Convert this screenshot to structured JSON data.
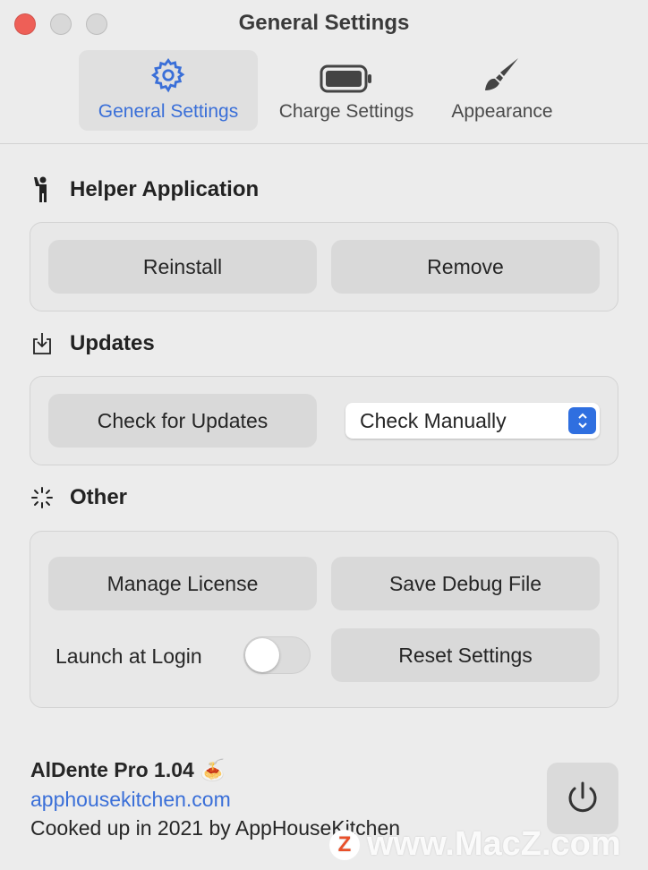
{
  "window": {
    "title": "General Settings",
    "colors": {
      "close": "#ee5f57",
      "inactive": "#d8d8d8",
      "accent": "#3a6fd8"
    }
  },
  "tabs": [
    {
      "label": "General Settings",
      "icon": "gear-icon",
      "selected": true
    },
    {
      "label": "Charge Settings",
      "icon": "battery-icon"
    },
    {
      "label": "Appearance",
      "icon": "paintbrush-icon"
    }
  ],
  "helper": {
    "title": "Helper Application",
    "reinstall": "Reinstall",
    "remove": "Remove"
  },
  "updates": {
    "title": "Updates",
    "check": "Check for Updates",
    "frequency": "Check Manually"
  },
  "other": {
    "title": "Other",
    "manage_license": "Manage License",
    "save_debug": "Save Debug File",
    "launch_at_login": "Launch at Login",
    "launch_at_login_on": false,
    "reset": "Reset Settings"
  },
  "footer": {
    "app": "AlDente Pro 1.04",
    "emoji": "🍝",
    "link": "apphousekitchen.com",
    "credit": "Cooked up in 2021 by AppHouseKitchen"
  },
  "watermark": {
    "logo": "Z",
    "text": "www.MacZ.com"
  }
}
